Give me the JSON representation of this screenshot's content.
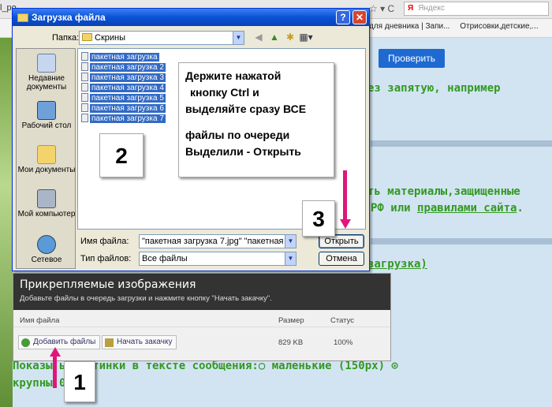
{
  "browser": {
    "url_fragment": "l_po",
    "nav_symbols": "☆ ▾ C",
    "search_placeholder": "Яндекс",
    "search_logo": "Я",
    "bookmarks": [
      "для дневника | Запи...",
      "Отрисовки,детские,..."
    ]
  },
  "page": {
    "check_button": "Проверить",
    "line1": "ез запятую, например",
    "line2": "ть материалы,защищенные",
    "line3_prefix": "РФ или ",
    "line3_link": "правилами сайта",
    "line3_suffix": ".",
    "line4": "загрузка)",
    "bottom1": "Показы   ь картинки в тексте сообщения:○ маленькие (150px) ⊙",
    "bottom2": "крупны   00px)"
  },
  "dialog": {
    "title": "Загрузка файла",
    "help": "?",
    "close": "✕",
    "folder_label": "Папка:",
    "folder_value": "Скрины",
    "places": [
      "Недавние документы",
      "Рабочий стол",
      "Мои документы",
      "Мой компьютер",
      "Сетевое"
    ],
    "files": [
      "пакетная загрузка",
      "пакетная загрузка 2",
      "пакетная загрузка 3",
      "пакетная загрузка 4",
      "пакетная загрузка 5",
      "пакетная загрузка 6",
      "пакетная загрузка 7"
    ],
    "filename_label": "Имя файла:",
    "filename_value": "\"пакетная загрузка 7.jpg\" \"пакетная загруз",
    "filetype_label": "Тип файлов:",
    "filetype_value": "Все файлы",
    "open_button": "Открыть",
    "cancel_button": "Отмена"
  },
  "callout": {
    "lines": [
      "Держите нажатой",
      "кнопку  Ctrl   и",
      "выделяйте сразу  ВСЕ",
      "файлы  по  очереди",
      "Выделили - Открыть"
    ],
    "step1": "1",
    "step2": "2",
    "step3": "3"
  },
  "attach": {
    "title": "Прикрепляемые изображения",
    "subtitle": "Добавьте файлы в очередь загрузки и нажмите кнопку \"Начать закачку\".",
    "col_name": "Имя файла",
    "col_size": "Размер",
    "col_status": "Статус",
    "add_button": "Добавить файлы",
    "start_button": "Начать закачку",
    "size_value": "829 KB",
    "status_value": "100%"
  },
  "colors": {
    "accent_arrow": "#e0167a",
    "title_bar": "#0a52d5",
    "selection": "#316ac5",
    "page_text": "#339922"
  }
}
